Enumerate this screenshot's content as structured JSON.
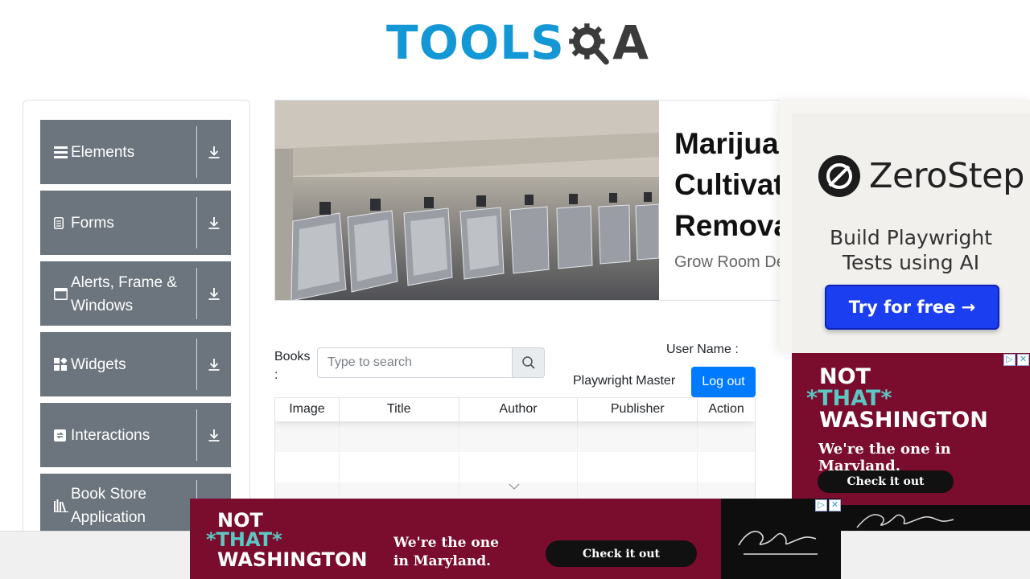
{
  "logo": {
    "text": "TOOLS",
    "letter": "A"
  },
  "sidebar": {
    "groups": [
      {
        "label": "Elements",
        "icon": "hamburger-icon"
      },
      {
        "label": "Forms",
        "icon": "document-icon"
      },
      {
        "label": "Alerts, Frame & Windows",
        "icon": "window-icon"
      },
      {
        "label": "Widgets",
        "icon": "widgets-icon"
      },
      {
        "label": "Interactions",
        "icon": "interactions-icon"
      },
      {
        "label": "Book Store Application",
        "icon": "books-icon"
      }
    ]
  },
  "banner": {
    "title": "Marijuana Cultivation Removal",
    "title_lines": [
      "Marijuan",
      "Cultivati",
      "Remova"
    ],
    "subtitle": "Grow Room De"
  },
  "books": {
    "label": "Books :",
    "search_placeholder": "Type to search",
    "user_label": "User Name :",
    "user_value": "Playwright Master",
    "logout_label": "Log out",
    "columns": [
      "Image",
      "Title",
      "Author",
      "Publisher",
      "Action"
    ]
  },
  "ads": {
    "zerostep": {
      "brand": "ZeroStep",
      "tagline_1": "Build Playwright",
      "tagline_2": "Tests using AI",
      "button": "Try for free →"
    },
    "washington": {
      "line1": "NOT",
      "line2": "*THAT*",
      "line3": "WASHINGTON",
      "tagline": "We're the one in Maryland.",
      "tagline_1": "We're the one",
      "tagline_2": "in Maryland.",
      "button": "Check it out",
      "brand_color": "#7a0c2e",
      "accent_color": "#5bc8c3"
    },
    "choices_mark": "▷",
    "close_mark": "✕"
  },
  "colors": {
    "sidebar": "#6c757d",
    "primary": "#007bff",
    "logo_blue": "#1498d5"
  }
}
